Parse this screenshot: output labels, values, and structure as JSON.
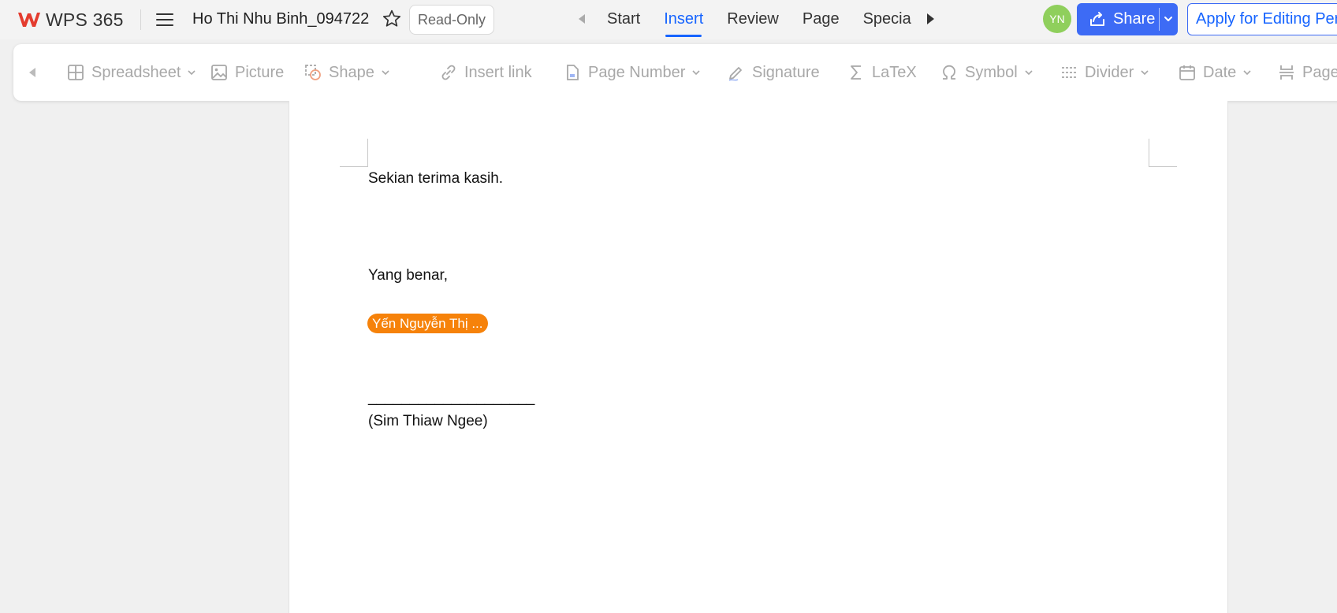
{
  "app": {
    "name": "WPS 365",
    "brand_color": "#e43c2f"
  },
  "header": {
    "doc_title": "Ho Thi Nhu Binh_094722",
    "readonly_label": "Read-Only",
    "tabs": [
      {
        "label": "Start",
        "active": false
      },
      {
        "label": "Insert",
        "active": true
      },
      {
        "label": "Review",
        "active": false
      },
      {
        "label": "Page",
        "active": false
      },
      {
        "label": "Specia",
        "active": false
      }
    ],
    "avatar_initials": "YN",
    "share_label": "Share",
    "apply_label": "Apply for Editing Permission",
    "accent_color": "#1664ff"
  },
  "toolbar": {
    "items": [
      {
        "label": "Spreadsheet",
        "icon": "table-icon",
        "dropdown": true
      },
      {
        "label": "Picture",
        "icon": "image-icon",
        "dropdown": false
      },
      {
        "label": "Shape",
        "icon": "shape-icon",
        "dropdown": true
      },
      {
        "label": "Insert link",
        "icon": "link-icon",
        "dropdown": false
      },
      {
        "label": "Page Number",
        "icon": "page-number-icon",
        "dropdown": true
      },
      {
        "label": "Signature",
        "icon": "pen-icon",
        "dropdown": false
      },
      {
        "label": "LaTeX",
        "icon": "sigma-icon",
        "dropdown": false
      },
      {
        "label": "Symbol",
        "icon": "omega-icon",
        "dropdown": true
      },
      {
        "label": "Divider",
        "icon": "divider-icon",
        "dropdown": true
      },
      {
        "label": "Date",
        "icon": "calendar-icon",
        "dropdown": true
      },
      {
        "label": "Page",
        "icon": "page-break-icon",
        "dropdown": false
      }
    ]
  },
  "document": {
    "closing": "Sekian terima kasih.",
    "salutation": "Yang benar,",
    "collaborator_tag": "Yến Nguyễn Thị ...",
    "signature_line": "____________________",
    "signer": "(Sim Thiaw Ngee)"
  }
}
